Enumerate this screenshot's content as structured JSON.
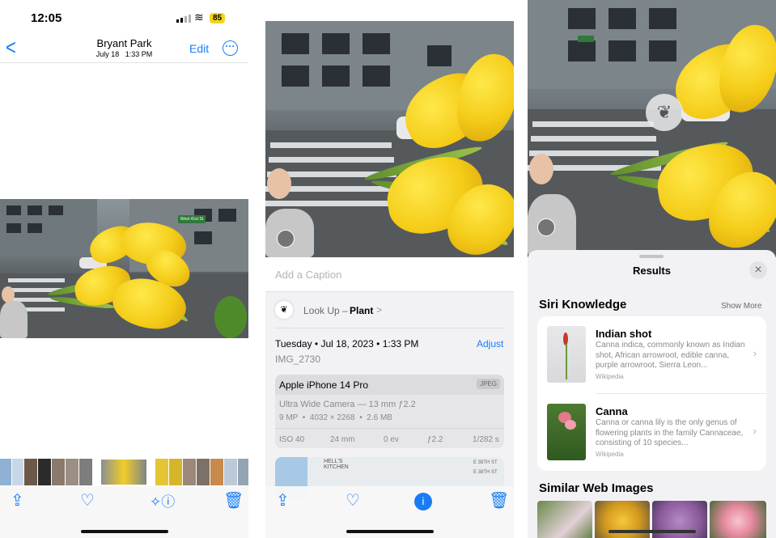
{
  "status": {
    "time": "12:05",
    "battery": "85"
  },
  "panel1": {
    "nav": {
      "back_glyph": "<",
      "title": "Bryant Park",
      "subtitle": "July 18   1:33 PM",
      "edit_label": "Edit",
      "more_glyph": "···"
    },
    "street_sign": "West 41st St",
    "toolbar": {
      "share_icon": "share-icon",
      "favorite_icon": "heart-icon",
      "info_icon": "info-sparkle-icon",
      "delete_icon": "trash-icon"
    }
  },
  "panel2": {
    "caption_placeholder": "Add a Caption",
    "lookup": {
      "label": "Look Up –",
      "subject": "Plant",
      "chevron": ">"
    },
    "datetime": "Tuesday • Jul 18, 2023 • 1:33 PM",
    "adjust_label": "Adjust",
    "filename": "IMG_2730",
    "camera": {
      "device": "Apple iPhone 14 Pro",
      "format": "JPEG",
      "lens": "Ultra Wide Camera — 13 mm ƒ2.2",
      "specs": "9 MP  •  4032 × 2268  •  2.6 MB",
      "exif": [
        "ISO 40",
        "24 mm",
        "0 ev",
        "ƒ2.2",
        "1/282 s"
      ]
    },
    "map": {
      "label": "HELL'S KITCHEN",
      "street1": "E 39TH ST",
      "street2": "E 38TH ST"
    }
  },
  "panel3": {
    "sheet_title": "Results",
    "close_glyph": "×",
    "section1": {
      "title": "Siri Knowledge",
      "action": "Show More"
    },
    "results": [
      {
        "title": "Indian shot",
        "description": "Canna indica, commonly known as Indian shot, African arrowroot, edible canna, purple arrowroot, Sierra Leon...",
        "source": "Wikipedia"
      },
      {
        "title": "Canna",
        "description": "Canna or canna lily is the only genus of flowering plants in the family Cannaceae, consisting of 10 species...",
        "source": "Wikipedia"
      }
    ],
    "section2": {
      "title": "Similar Web Images"
    }
  },
  "colors": {
    "accent": "#1a7cf5",
    "flower": "#f4cc18",
    "background": "#f2f2f5"
  }
}
